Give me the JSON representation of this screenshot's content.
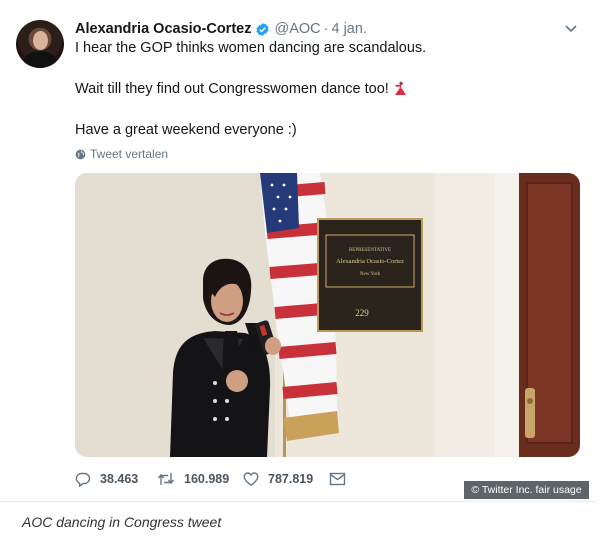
{
  "tweet": {
    "author_name": "Alexandria Ocasio-Cortez",
    "handle": "@AOC",
    "separator": "·",
    "date": "4 jan.",
    "lines": [
      "I hear the GOP thinks women dancing are scandalous.",
      "Wait till they find out Congresswomen dance too!",
      "Have a great weekend everyone :)"
    ],
    "translate_label": "Tweet vertalen",
    "media": {
      "plaque_title": "REPRESENTATIVE",
      "plaque_name": "Alexandria Ocasio-Cortez",
      "plaque_state": "New York",
      "room_number": "229"
    },
    "stats": {
      "replies": "38.463",
      "retweets": "160.989",
      "likes": "787.819"
    }
  },
  "credit": "© Twitter Inc. fair usage",
  "caption": "AOC dancing in Congress tweet",
  "colors": {
    "verified": "#1da1f2",
    "secondary_text": "#657786",
    "dancer_emoji": "#d62d4a"
  },
  "icons": [
    "verified-badge-icon",
    "chevron-down-icon",
    "globe-icon",
    "dancer-emoji-icon",
    "reply-icon",
    "retweet-icon",
    "like-icon",
    "message-icon"
  ]
}
